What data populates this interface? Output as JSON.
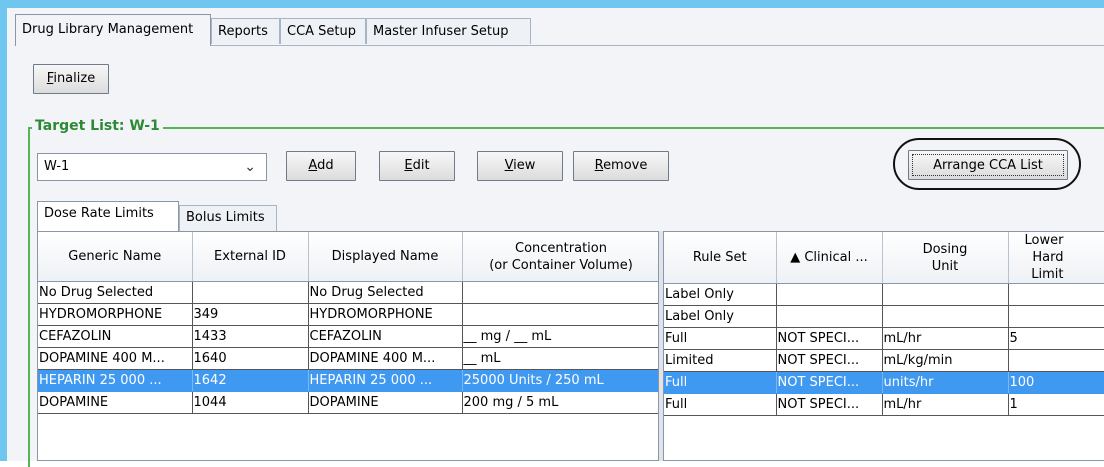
{
  "tabs": [
    "Drug Library Management",
    "Reports",
    "CCA Setup",
    "Master Infuser Setup"
  ],
  "toolbar": {
    "finalize_first": "F",
    "finalize_rest": "inalize"
  },
  "target_list": {
    "title": "Target List: W-1",
    "selected": "W-1",
    "chevron": "⌄"
  },
  "buttons": {
    "add_first": "A",
    "add_rest": "dd",
    "edit_first": "E",
    "edit_rest": "dit",
    "view_first": "V",
    "view_rest": "iew",
    "remove_first": "R",
    "remove_rest": "emove",
    "arrange": "Arrange CCA List"
  },
  "subtabs": [
    "Dose Rate Limits",
    "Bolus Limits"
  ],
  "left_table": {
    "headers": [
      {
        "line1": "Generic Name",
        "line2": ""
      },
      {
        "line1": "External ID",
        "line2": ""
      },
      {
        "line1": "Displayed Name",
        "line2": ""
      },
      {
        "line1": "Concentration",
        "line2": "(or Container Volume)"
      }
    ],
    "rows": [
      [
        "No Drug Selected",
        "",
        "No Drug Selected",
        ""
      ],
      [
        "HYDROMORPHONE",
        "349",
        "HYDROMORPHONE",
        ""
      ],
      [
        "CEFAZOLIN",
        "1433",
        "CEFAZOLIN",
        "__ mg / __ mL"
      ],
      [
        "DOPAMINE 400 M...",
        "1640",
        "DOPAMINE 400 M...",
        "__ mL"
      ],
      [
        "HEPARIN 25 000 ...",
        "1642",
        "HEPARIN 25 000 ...",
        "25000 Units / 250 mL"
      ],
      [
        "DOPAMINE",
        "1044",
        "DOPAMINE",
        "200 mg / 5 mL"
      ]
    ]
  },
  "right_table": {
    "headers": [
      {
        "line1": "Rule Set",
        "line2": ""
      },
      {
        "line1": "▲ Clinical ...",
        "line2": ""
      },
      {
        "line1": "Dosing",
        "line2": "Unit"
      },
      {
        "line1": "Lower",
        "line2": "Hard Limit"
      }
    ],
    "rows": [
      [
        "Label Only",
        "",
        "",
        ""
      ],
      [
        "Label Only",
        "",
        "",
        ""
      ],
      [
        "Full",
        "NOT SPECI...",
        "mL/hr",
        "5"
      ],
      [
        "Limited",
        "NOT SPECI...",
        "mL/kg/min",
        ""
      ],
      [
        "Full",
        "NOT SPECI...",
        "units/hr",
        "100"
      ],
      [
        "Full",
        "NOT SPECI...",
        "mL/hr",
        "1"
      ]
    ]
  },
  "selected_row_index": 4,
  "colors": {
    "accent": "#3f99f0",
    "group_border": "#55b35a",
    "frame": "#6fc6ee"
  }
}
